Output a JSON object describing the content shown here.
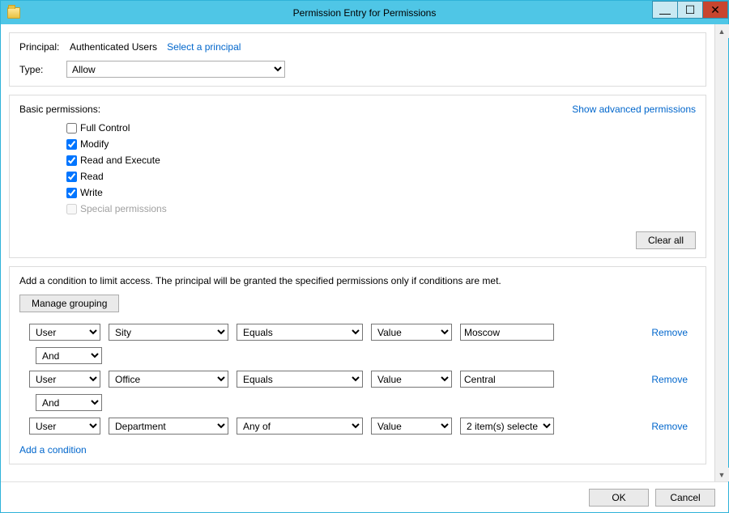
{
  "window": {
    "title": "Permission Entry for Permissions"
  },
  "principal": {
    "label": "Principal:",
    "value": "Authenticated Users",
    "select_link": "Select a principal"
  },
  "type": {
    "label": "Type:",
    "value": "Allow"
  },
  "basic": {
    "header": "Basic permissions:",
    "advanced_link": "Show advanced permissions",
    "items": [
      {
        "label": "Full Control",
        "checked": false,
        "disabled": false
      },
      {
        "label": "Modify",
        "checked": true,
        "disabled": false
      },
      {
        "label": "Read and Execute",
        "checked": true,
        "disabled": false
      },
      {
        "label": "Read",
        "checked": true,
        "disabled": false
      },
      {
        "label": "Write",
        "checked": true,
        "disabled": false
      },
      {
        "label": "Special permissions",
        "checked": false,
        "disabled": true
      }
    ],
    "clear_all": "Clear all"
  },
  "conditions": {
    "description": "Add a condition to limit access. The principal will be granted the specified permissions only if conditions are met.",
    "manage_grouping": "Manage grouping",
    "rows": [
      {
        "subject": "User",
        "attribute": "Sity",
        "operator": "Equals",
        "value_type": "Value",
        "value": "Moscow"
      },
      {
        "subject": "User",
        "attribute": "Office",
        "operator": "Equals",
        "value_type": "Value",
        "value": "Central"
      },
      {
        "subject": "User",
        "attribute": "Department",
        "operator": "Any of",
        "value_type": "Value",
        "value": "2 item(s) selected"
      }
    ],
    "connectors": [
      "And",
      "And"
    ],
    "remove": "Remove",
    "add": "Add a condition"
  },
  "footer": {
    "ok": "OK",
    "cancel": "Cancel"
  }
}
